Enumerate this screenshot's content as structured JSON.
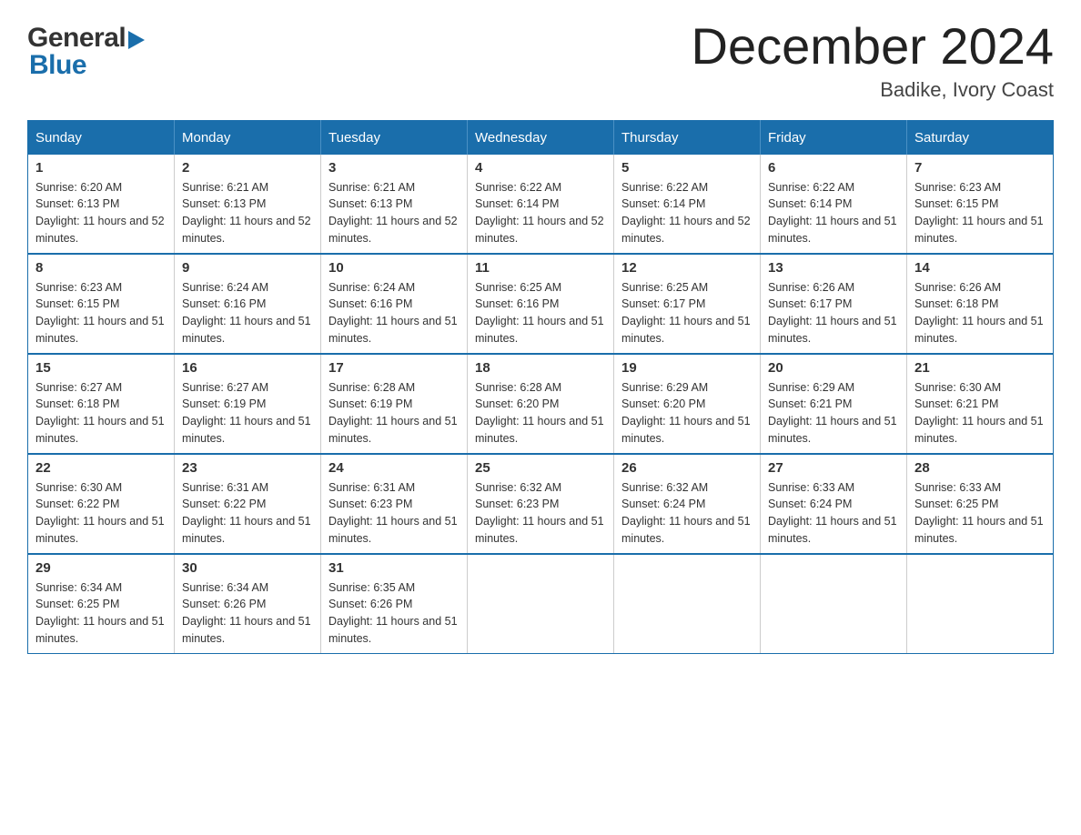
{
  "header": {
    "logo": {
      "general": "General",
      "blue": "Blue"
    },
    "title": "December 2024",
    "location": "Badike, Ivory Coast"
  },
  "calendar": {
    "days_of_week": [
      "Sunday",
      "Monday",
      "Tuesday",
      "Wednesday",
      "Thursday",
      "Friday",
      "Saturday"
    ],
    "weeks": [
      [
        {
          "day": "1",
          "sunrise": "6:20 AM",
          "sunset": "6:13 PM",
          "daylight": "11 hours and 52 minutes."
        },
        {
          "day": "2",
          "sunrise": "6:21 AM",
          "sunset": "6:13 PM",
          "daylight": "11 hours and 52 minutes."
        },
        {
          "day": "3",
          "sunrise": "6:21 AM",
          "sunset": "6:13 PM",
          "daylight": "11 hours and 52 minutes."
        },
        {
          "day": "4",
          "sunrise": "6:22 AM",
          "sunset": "6:14 PM",
          "daylight": "11 hours and 52 minutes."
        },
        {
          "day": "5",
          "sunrise": "6:22 AM",
          "sunset": "6:14 PM",
          "daylight": "11 hours and 52 minutes."
        },
        {
          "day": "6",
          "sunrise": "6:22 AM",
          "sunset": "6:14 PM",
          "daylight": "11 hours and 51 minutes."
        },
        {
          "day": "7",
          "sunrise": "6:23 AM",
          "sunset": "6:15 PM",
          "daylight": "11 hours and 51 minutes."
        }
      ],
      [
        {
          "day": "8",
          "sunrise": "6:23 AM",
          "sunset": "6:15 PM",
          "daylight": "11 hours and 51 minutes."
        },
        {
          "day": "9",
          "sunrise": "6:24 AM",
          "sunset": "6:16 PM",
          "daylight": "11 hours and 51 minutes."
        },
        {
          "day": "10",
          "sunrise": "6:24 AM",
          "sunset": "6:16 PM",
          "daylight": "11 hours and 51 minutes."
        },
        {
          "day": "11",
          "sunrise": "6:25 AM",
          "sunset": "6:16 PM",
          "daylight": "11 hours and 51 minutes."
        },
        {
          "day": "12",
          "sunrise": "6:25 AM",
          "sunset": "6:17 PM",
          "daylight": "11 hours and 51 minutes."
        },
        {
          "day": "13",
          "sunrise": "6:26 AM",
          "sunset": "6:17 PM",
          "daylight": "11 hours and 51 minutes."
        },
        {
          "day": "14",
          "sunrise": "6:26 AM",
          "sunset": "6:18 PM",
          "daylight": "11 hours and 51 minutes."
        }
      ],
      [
        {
          "day": "15",
          "sunrise": "6:27 AM",
          "sunset": "6:18 PM",
          "daylight": "11 hours and 51 minutes."
        },
        {
          "day": "16",
          "sunrise": "6:27 AM",
          "sunset": "6:19 PM",
          "daylight": "11 hours and 51 minutes."
        },
        {
          "day": "17",
          "sunrise": "6:28 AM",
          "sunset": "6:19 PM",
          "daylight": "11 hours and 51 minutes."
        },
        {
          "day": "18",
          "sunrise": "6:28 AM",
          "sunset": "6:20 PM",
          "daylight": "11 hours and 51 minutes."
        },
        {
          "day": "19",
          "sunrise": "6:29 AM",
          "sunset": "6:20 PM",
          "daylight": "11 hours and 51 minutes."
        },
        {
          "day": "20",
          "sunrise": "6:29 AM",
          "sunset": "6:21 PM",
          "daylight": "11 hours and 51 minutes."
        },
        {
          "day": "21",
          "sunrise": "6:30 AM",
          "sunset": "6:21 PM",
          "daylight": "11 hours and 51 minutes."
        }
      ],
      [
        {
          "day": "22",
          "sunrise": "6:30 AM",
          "sunset": "6:22 PM",
          "daylight": "11 hours and 51 minutes."
        },
        {
          "day": "23",
          "sunrise": "6:31 AM",
          "sunset": "6:22 PM",
          "daylight": "11 hours and 51 minutes."
        },
        {
          "day": "24",
          "sunrise": "6:31 AM",
          "sunset": "6:23 PM",
          "daylight": "11 hours and 51 minutes."
        },
        {
          "day": "25",
          "sunrise": "6:32 AM",
          "sunset": "6:23 PM",
          "daylight": "11 hours and 51 minutes."
        },
        {
          "day": "26",
          "sunrise": "6:32 AM",
          "sunset": "6:24 PM",
          "daylight": "11 hours and 51 minutes."
        },
        {
          "day": "27",
          "sunrise": "6:33 AM",
          "sunset": "6:24 PM",
          "daylight": "11 hours and 51 minutes."
        },
        {
          "day": "28",
          "sunrise": "6:33 AM",
          "sunset": "6:25 PM",
          "daylight": "11 hours and 51 minutes."
        }
      ],
      [
        {
          "day": "29",
          "sunrise": "6:34 AM",
          "sunset": "6:25 PM",
          "daylight": "11 hours and 51 minutes."
        },
        {
          "day": "30",
          "sunrise": "6:34 AM",
          "sunset": "6:26 PM",
          "daylight": "11 hours and 51 minutes."
        },
        {
          "day": "31",
          "sunrise": "6:35 AM",
          "sunset": "6:26 PM",
          "daylight": "11 hours and 51 minutes."
        },
        null,
        null,
        null,
        null
      ]
    ],
    "labels": {
      "sunrise": "Sunrise:",
      "sunset": "Sunset:",
      "daylight": "Daylight:"
    }
  }
}
